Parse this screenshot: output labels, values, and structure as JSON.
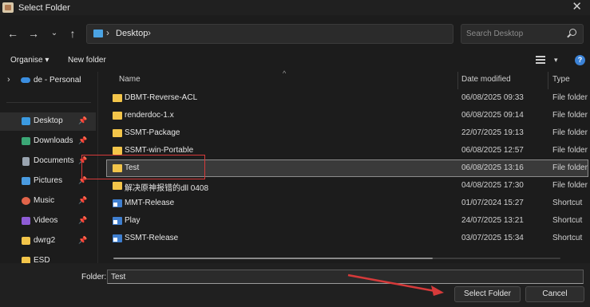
{
  "window": {
    "title": "Select Folder"
  },
  "address": {
    "location": "Desktop"
  },
  "search": {
    "placeholder": "Search Desktop"
  },
  "toolbar": {
    "organise": "Organise",
    "new_folder": "New folder"
  },
  "sidebar": {
    "top": "de - Personal",
    "items": [
      {
        "label": "Desktop",
        "icon": "desktop-icon",
        "color": "#3b9ae1"
      },
      {
        "label": "Downloads",
        "icon": "download-icon",
        "color": "#3ba776"
      },
      {
        "label": "Documents",
        "icon": "document-icon",
        "color": "#9aa4b0"
      },
      {
        "label": "Pictures",
        "icon": "picture-icon",
        "color": "#4a9be0"
      },
      {
        "label": "Music",
        "icon": "music-icon",
        "color": "#e2644a"
      },
      {
        "label": "Videos",
        "icon": "video-icon",
        "color": "#8e5cd6"
      },
      {
        "label": "dwrg2",
        "icon": "folder-icon",
        "color": "#f3c54a"
      },
      {
        "label": "ESD",
        "icon": "folder-icon",
        "color": "#f3c54a"
      }
    ]
  },
  "columns": {
    "name": "Name",
    "date": "Date modified",
    "type": "Type"
  },
  "files": [
    {
      "name": "DBMT-Reverse-ACL",
      "date": "06/08/2025 09:33",
      "type": "File folder",
      "kind": "folder"
    },
    {
      "name": "renderdoc-1.x",
      "date": "06/08/2025 09:14",
      "type": "File folder",
      "kind": "folder"
    },
    {
      "name": "SSMT-Package",
      "date": "22/07/2025 19:13",
      "type": "File folder",
      "kind": "folder"
    },
    {
      "name": "SSMT-win-Portable",
      "date": "06/08/2025 12:57",
      "type": "File folder",
      "kind": "folder"
    },
    {
      "name": "Test",
      "date": "06/08/2025 13:16",
      "type": "File folder",
      "kind": "folder"
    },
    {
      "name": "解决原神报错的dll 0408",
      "date": "04/08/2025 17:30",
      "type": "File folder",
      "kind": "folder"
    },
    {
      "name": "MMT-Release",
      "date": "01/07/2024 15:27",
      "type": "Shortcut",
      "kind": "shortcut"
    },
    {
      "name": "Play",
      "date": "24/07/2025 13:21",
      "type": "Shortcut",
      "kind": "shortcut"
    },
    {
      "name": "SSMT-Release",
      "date": "03/07/2025 15:34",
      "type": "Shortcut",
      "kind": "shortcut"
    }
  ],
  "folder_field": {
    "label": "Folder:",
    "value": "Test"
  },
  "buttons": {
    "select": "Select Folder",
    "cancel": "Cancel"
  },
  "colors": {
    "annotation": "#d63a3a",
    "folder": "#f3c54a",
    "accent": "#3b82d6"
  }
}
